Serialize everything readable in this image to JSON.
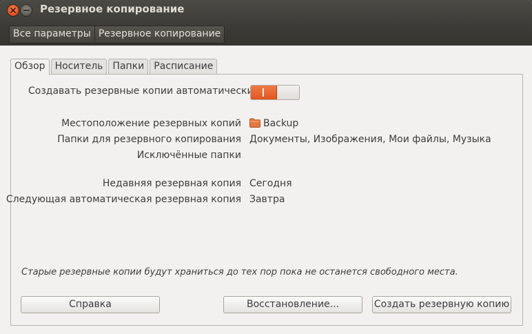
{
  "window": {
    "title": "Резервное копирование"
  },
  "toolbar": {
    "breadcrumbs": [
      "Все параметры",
      "Резервное копирование"
    ]
  },
  "tabs": [
    {
      "label": "Обзор",
      "active": true
    },
    {
      "label": "Носитель",
      "active": false
    },
    {
      "label": "Папки",
      "active": false
    },
    {
      "label": "Расписание",
      "active": false
    }
  ],
  "overview": {
    "auto_backup_label": "Создавать резервные копии автоматически",
    "auto_backup_on": true,
    "rows": [
      {
        "label": "Местоположение резервных копий",
        "value": "Backup",
        "icon": "folder-icon"
      },
      {
        "label": "Папки для резервного копирования",
        "value": "Документы, Изображения, Мои файлы, Музыка"
      },
      {
        "label": "Исключённые папки",
        "value": ""
      },
      {
        "label": "Недавняя резервная копия",
        "value": "Сегодня"
      },
      {
        "label": "Следующая автоматическая резервная копия",
        "value": "Завтра"
      }
    ],
    "note": "Старые резервные копии будут храниться до тех пор пока не останется свободного места."
  },
  "buttons": {
    "help": "Справка",
    "restore": "Восстановление...",
    "backup_now": "Создать резервную копию"
  },
  "colors": {
    "accent": "#e0561f",
    "titlebar": "#3c3b37",
    "background": "#f2f1f0"
  }
}
